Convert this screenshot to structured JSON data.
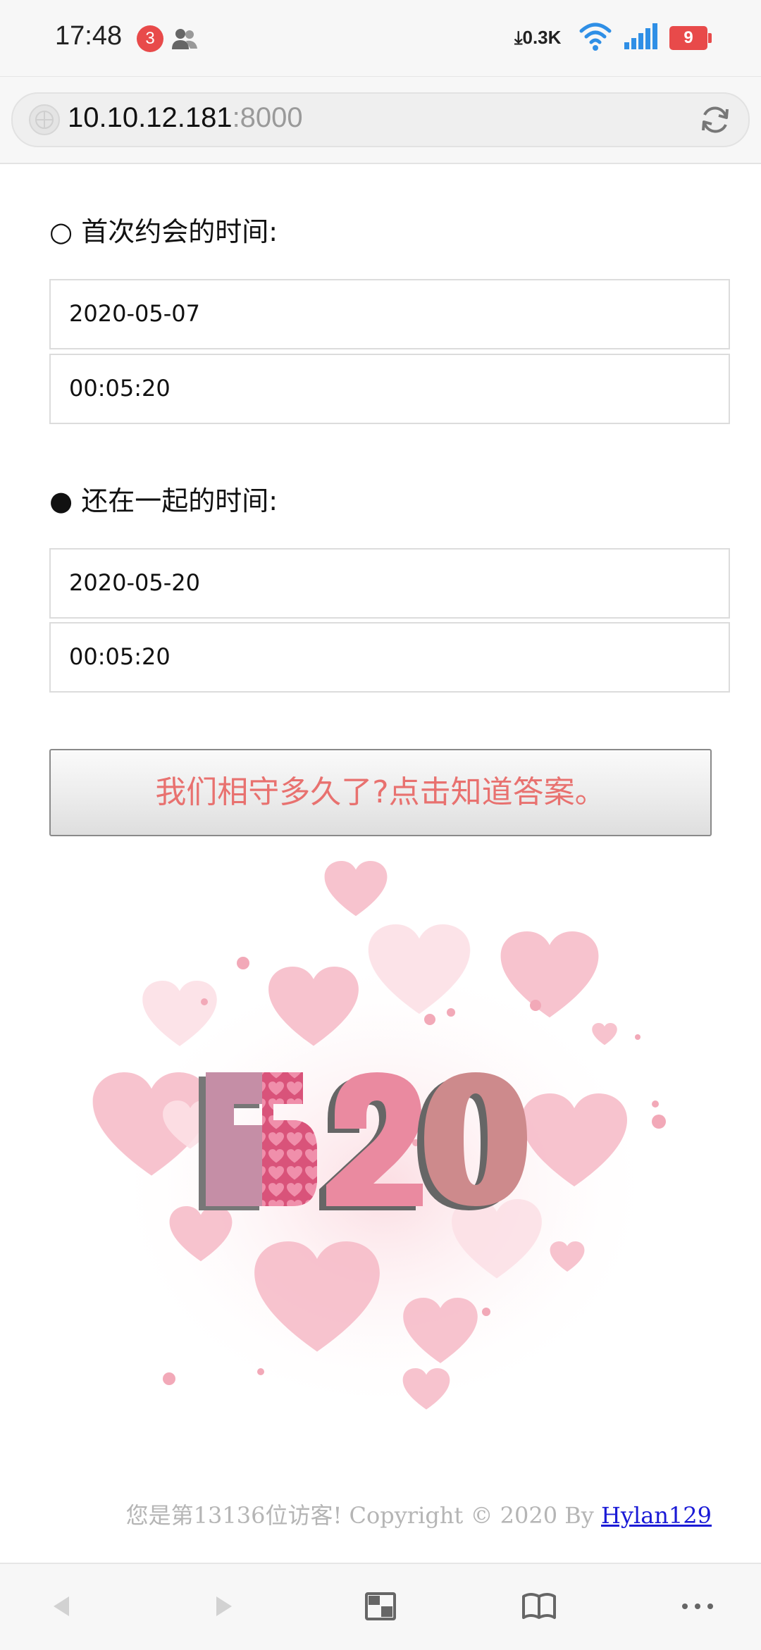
{
  "status_bar": {
    "time": "17:48",
    "notification_count": "3",
    "net_speed": "0.3K",
    "battery": "9"
  },
  "address_bar": {
    "host": "10.10.12.181",
    "port": ":8000"
  },
  "page": {
    "first_date_label": "○ 首次约会的时间:",
    "first_date": "2020-05-07",
    "first_time": "00:05:20",
    "together_label": "● 还在一起的时间:",
    "together_date": "2020-05-20",
    "together_time": "00:05:20",
    "answer_button": "我们相守多久了?点击知道答案。",
    "art_text": "520",
    "footer_text": "您是第13136位访客!  Copyright © 2020 By ",
    "footer_link": "Hylan129"
  },
  "bottom_nav": {
    "items": [
      "back",
      "forward",
      "tabs",
      "bookmarks",
      "more"
    ]
  },
  "colors": {
    "accent_pink": "#e8716f",
    "badge_red": "#e84a4a",
    "link_blue": "#1a1ad6"
  }
}
